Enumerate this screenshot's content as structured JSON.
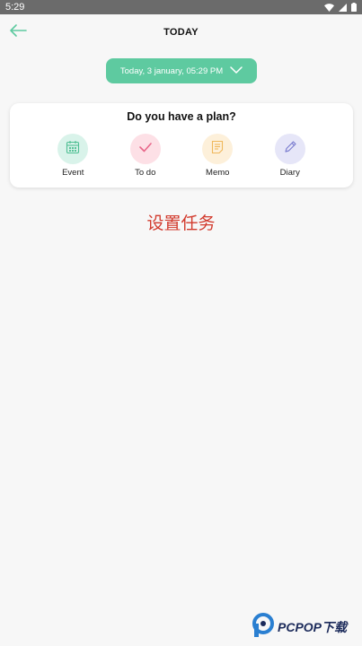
{
  "status_bar": {
    "time": "5:29"
  },
  "header": {
    "title": "TODAY"
  },
  "date_selector": {
    "label": "Today, 3 january, 05:29 PM"
  },
  "plan_card": {
    "title": "Do you have a plan?",
    "options": [
      {
        "label": "Event",
        "icon": "calendar-icon",
        "bg": "#d9f3ea",
        "color": "#4fbf93"
      },
      {
        "label": "To do",
        "icon": "checkmark-icon",
        "bg": "#fde0e6",
        "color": "#e8678a"
      },
      {
        "label": "Memo",
        "icon": "note-icon",
        "bg": "#fdf0da",
        "color": "#f0b85c"
      },
      {
        "label": "Diary",
        "icon": "pencil-icon",
        "bg": "#e6e6f8",
        "color": "#7d7fd0"
      }
    ]
  },
  "caption": "设置任务",
  "watermark": {
    "brand": "PCPOP下载"
  },
  "colors": {
    "accent": "#5ecaa0",
    "caption": "#d23a2d"
  }
}
